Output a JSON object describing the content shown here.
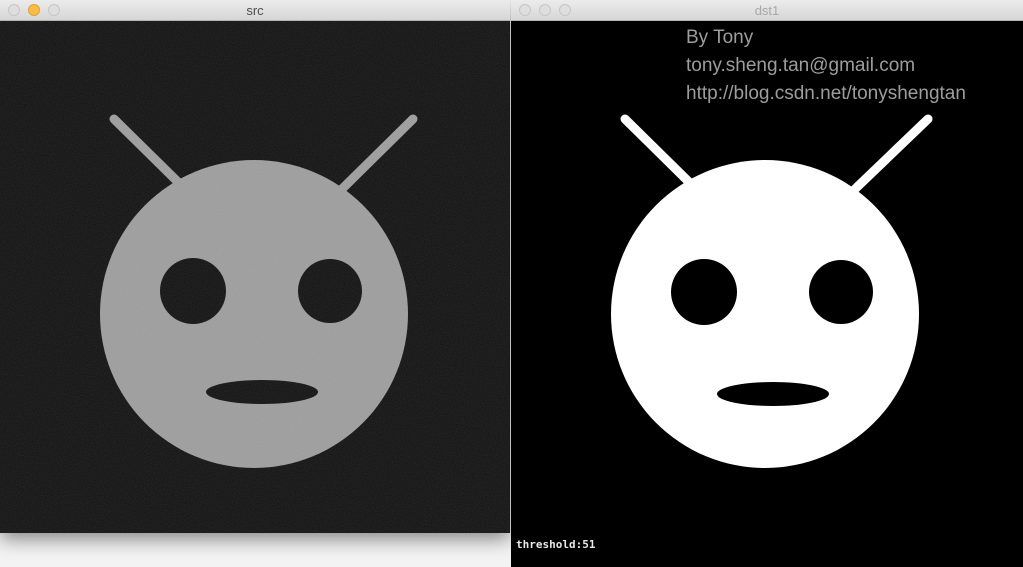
{
  "src_window": {
    "title": "src",
    "canvas_bg": "#111111",
    "face_color": "#9b9b9b"
  },
  "dst_window": {
    "title": "dst1",
    "canvas_bg": "#000000",
    "face_color": "#ffffff",
    "overlay": {
      "line1": "By Tony",
      "line2": "tony.sheng.tan@gmail.com",
      "line3": "http://blog.csdn.net/tonyshengtan"
    },
    "status": "threshold:51"
  }
}
